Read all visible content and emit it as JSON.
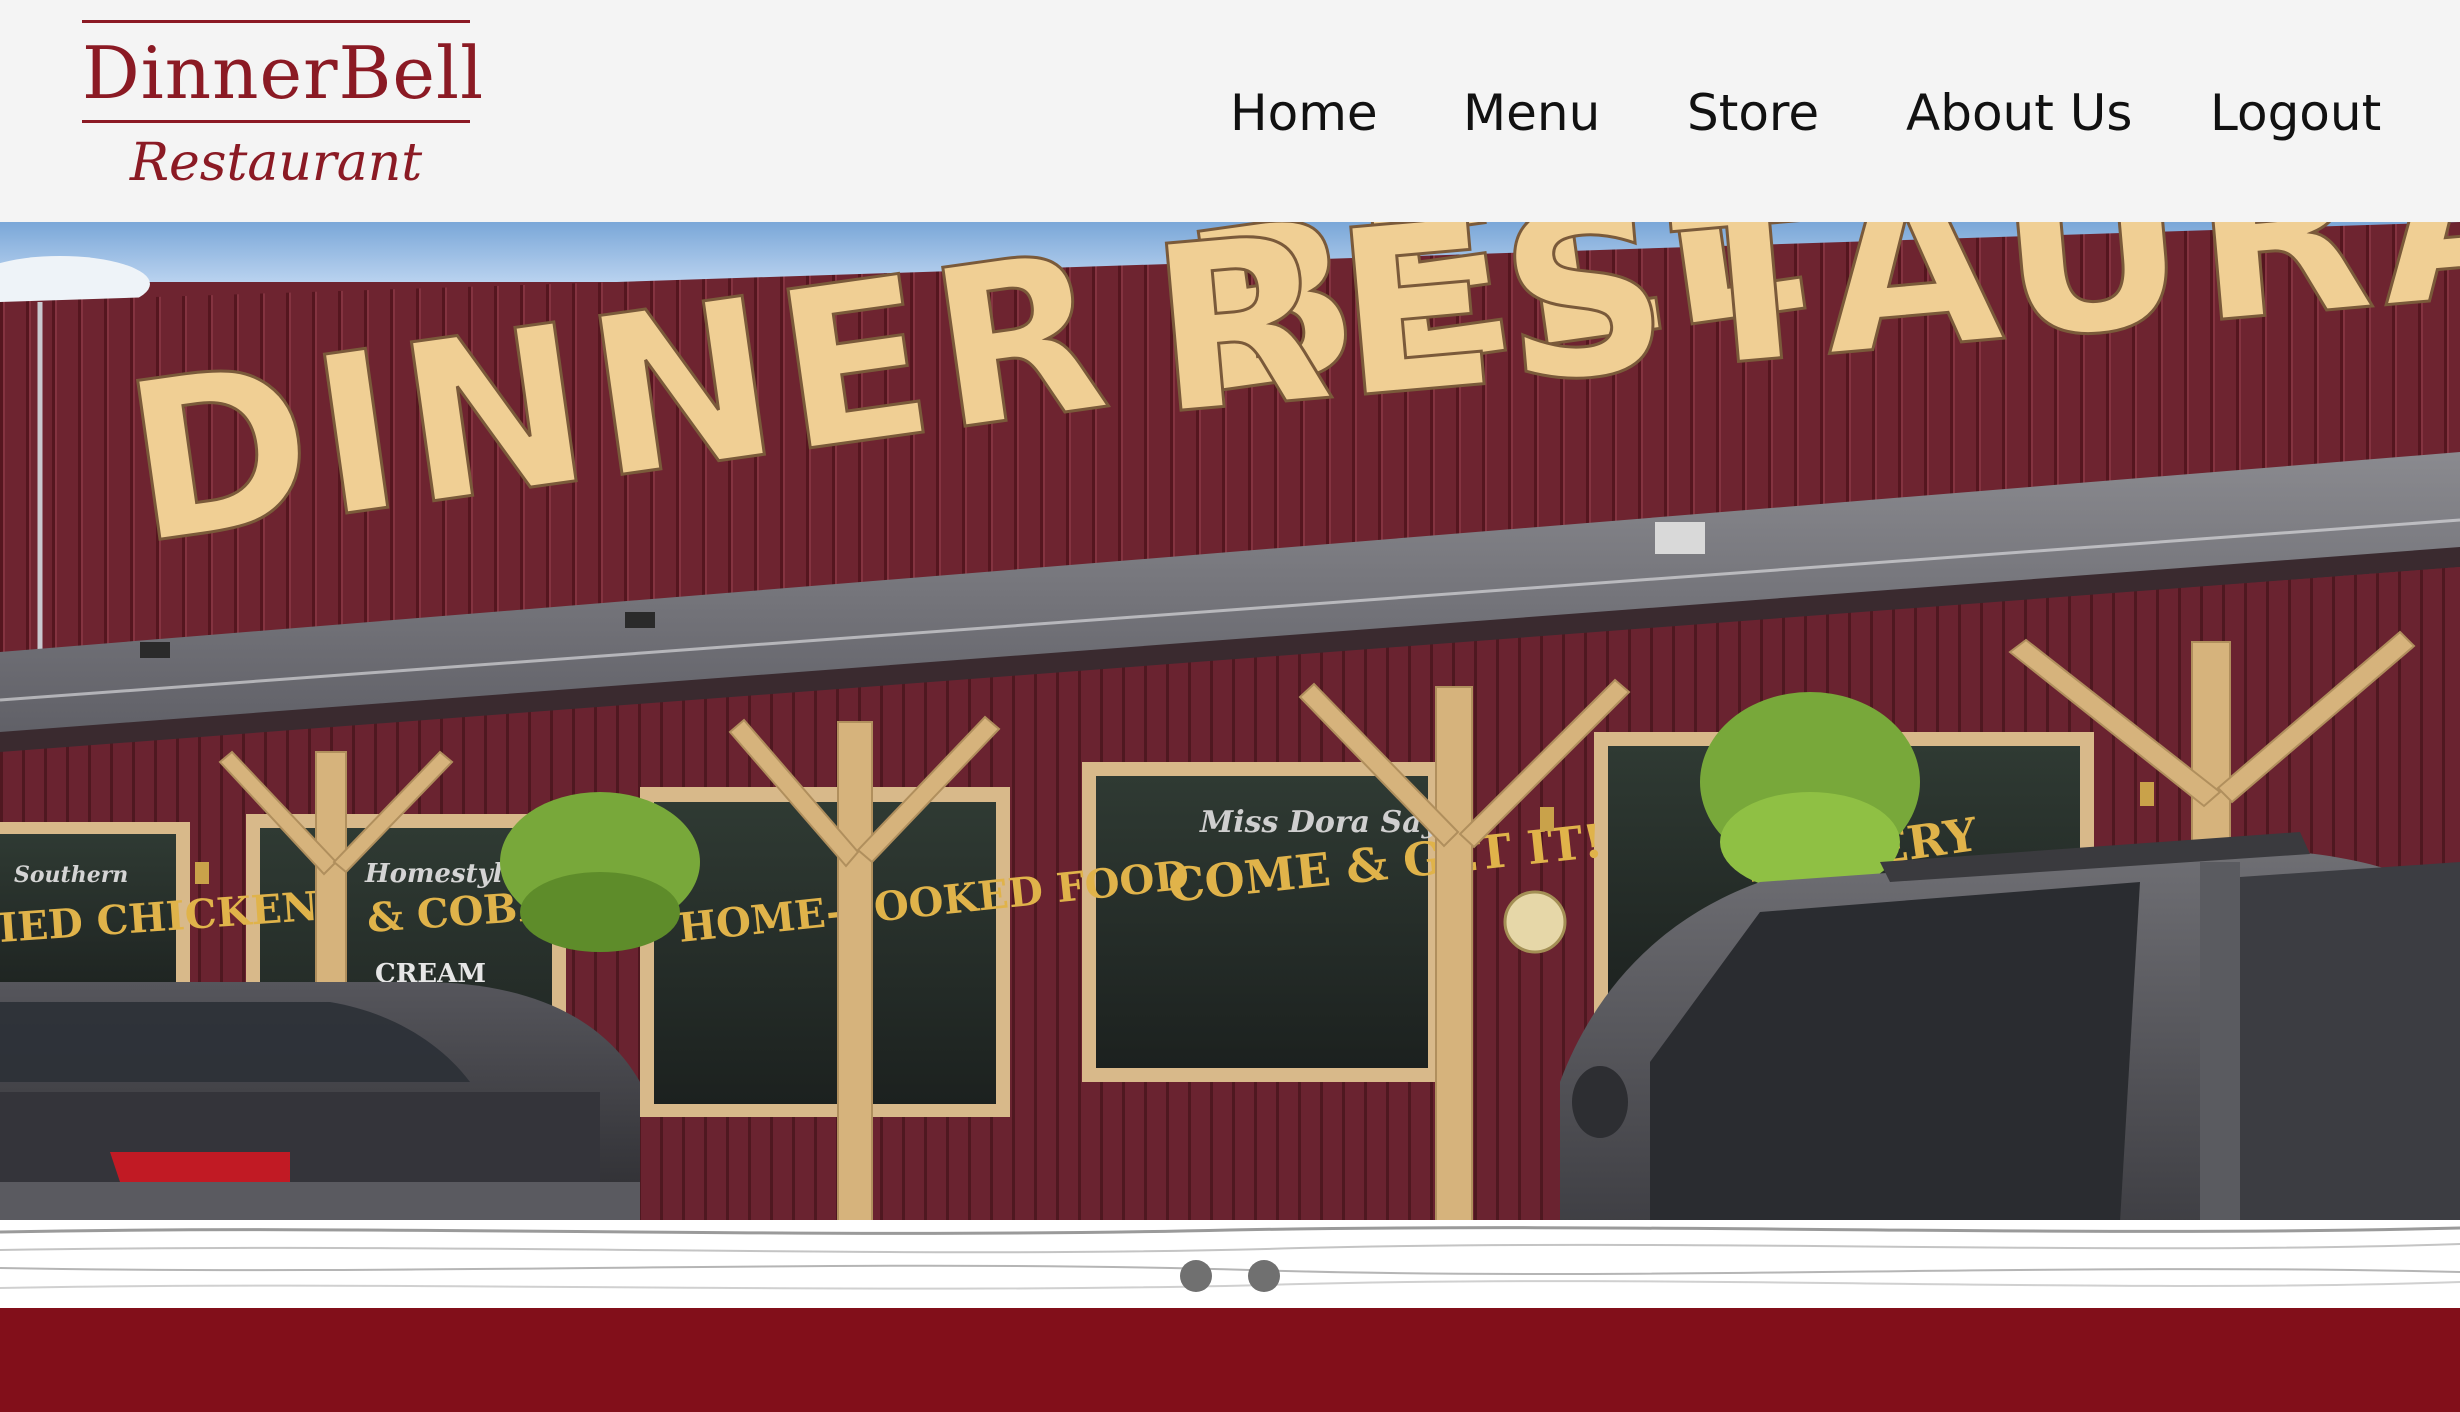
{
  "brand": {
    "name": "DinnerBell",
    "subtitle": "Restaurant",
    "color": "#8b1a24"
  },
  "nav": {
    "items": [
      {
        "label": "Home"
      },
      {
        "label": "Menu"
      },
      {
        "label": "Store"
      },
      {
        "label": "About Us"
      },
      {
        "label": "Logout"
      }
    ]
  },
  "hero": {
    "sign_text": "DINNER BELL RESTAURANT",
    "window_signs": [
      "Southern",
      "FRIED CHICKEN",
      "Homestyle",
      "& COBBLERS",
      "CREAM",
      "HOME-COOKED FOOD",
      "Miss Dora Says",
      "COME & GET IT!",
      "POWERY"
    ]
  },
  "slider": {
    "dot_count": 2,
    "active_index": 0
  },
  "colors": {
    "header_bg": "#f4f4f4",
    "accent_red": "#820f1a",
    "dot": "#707070"
  }
}
